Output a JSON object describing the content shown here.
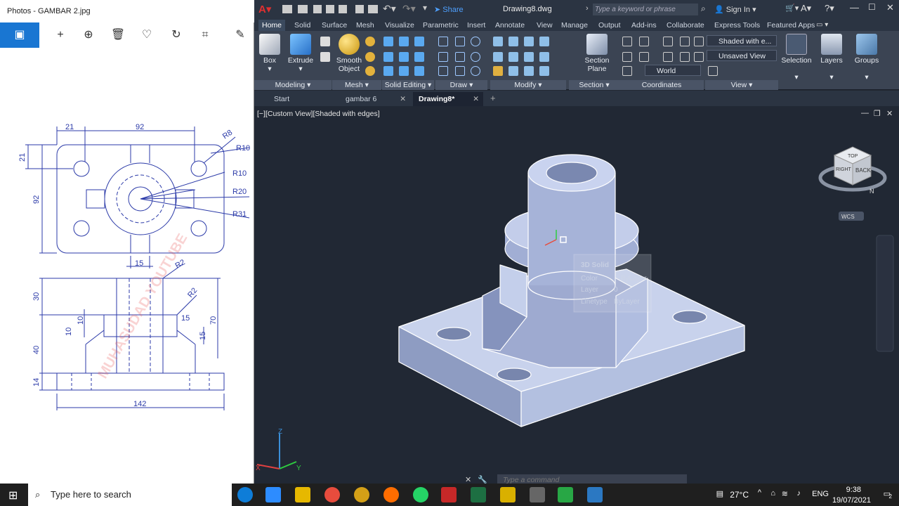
{
  "photos": {
    "title": "Photos - GAMBAR 2.jpg",
    "toolbar_icons": [
      "image-icon",
      "plus-icon",
      "zoom-in-icon",
      "delete-icon",
      "heart-icon",
      "rotate-icon",
      "crop-icon",
      "edit-icon"
    ],
    "drawing_dims": {
      "d21a": "21",
      "d92a": "92",
      "r8": "R8",
      "r10a": "R10",
      "d21b": "21",
      "d92b": "92",
      "r10b": "R10",
      "r20": "R20",
      "r31": "R31",
      "d15a": "15",
      "r2a": "R2",
      "d30": "30",
      "r2b": "R2",
      "d10a": "10",
      "d10b": "10",
      "d15b": "15",
      "d70": "70",
      "d15c": "15",
      "d40": "40",
      "d14": "14",
      "d142": "142"
    },
    "watermark": "MUHASUDAD YOUTUBE"
  },
  "acad": {
    "doc_title": "Drawing8.dwg",
    "share": "Share",
    "search_placeholder": "Type a keyword or phrase",
    "sign_in": "Sign In",
    "ribbon_tabs": [
      "Home",
      "Solid",
      "Surface",
      "Mesh",
      "Visualize",
      "Parametric",
      "Insert",
      "Annotate",
      "View",
      "Manage",
      "Output",
      "Add-ins",
      "Collaborate",
      "Express Tools",
      "Featured Apps"
    ],
    "buttons": {
      "box": "Box",
      "extrude": "Extrude",
      "smooth": "Smooth",
      "object": "Object",
      "section": "Section",
      "plane": "Plane",
      "selection": "Selection",
      "layers": "Layers",
      "groups": "Groups"
    },
    "dropdowns": {
      "visual_style": "Shaded with e...",
      "view": "Unsaved View",
      "ucs": "World"
    },
    "panels": {
      "modeling": "Modeling",
      "mesh": "Mesh",
      "solid_editing": "Solid Editing",
      "draw": "Draw",
      "modify": "Modify",
      "section": "Section",
      "coordinates": "Coordinates",
      "view": "View"
    },
    "doc_tabs": [
      {
        "label": "Start"
      },
      {
        "label": "gambar 6"
      },
      {
        "label": "Drawing8*"
      }
    ],
    "viewport_label": "[−][Custom View][Shaded with edges]",
    "viewcube": {
      "top": "TOP",
      "right": "RIGHT",
      "back": "BACK",
      "wcs": "WCS",
      "n": "N"
    },
    "tooltip": {
      "title": "3D Solid",
      "color_label": "Color",
      "color_value": "ByLayer",
      "layer_label": "Layer",
      "layer_value": "0",
      "linetype_label": "Linetype",
      "linetype_value": "ByLayer"
    },
    "command_placeholder": "Type a command",
    "axes": {
      "x": "X",
      "y": "Y",
      "z": "Z"
    }
  },
  "taskbar": {
    "search_placeholder": "Type here to search",
    "temperature": "27°C",
    "language": "ENG",
    "time": "9:38",
    "date": "19/07/2021",
    "notifications": "2"
  },
  "colors": {
    "accent": "#1976d2",
    "blueprint": "#2b3aa8",
    "acad_bg": "#212834"
  }
}
